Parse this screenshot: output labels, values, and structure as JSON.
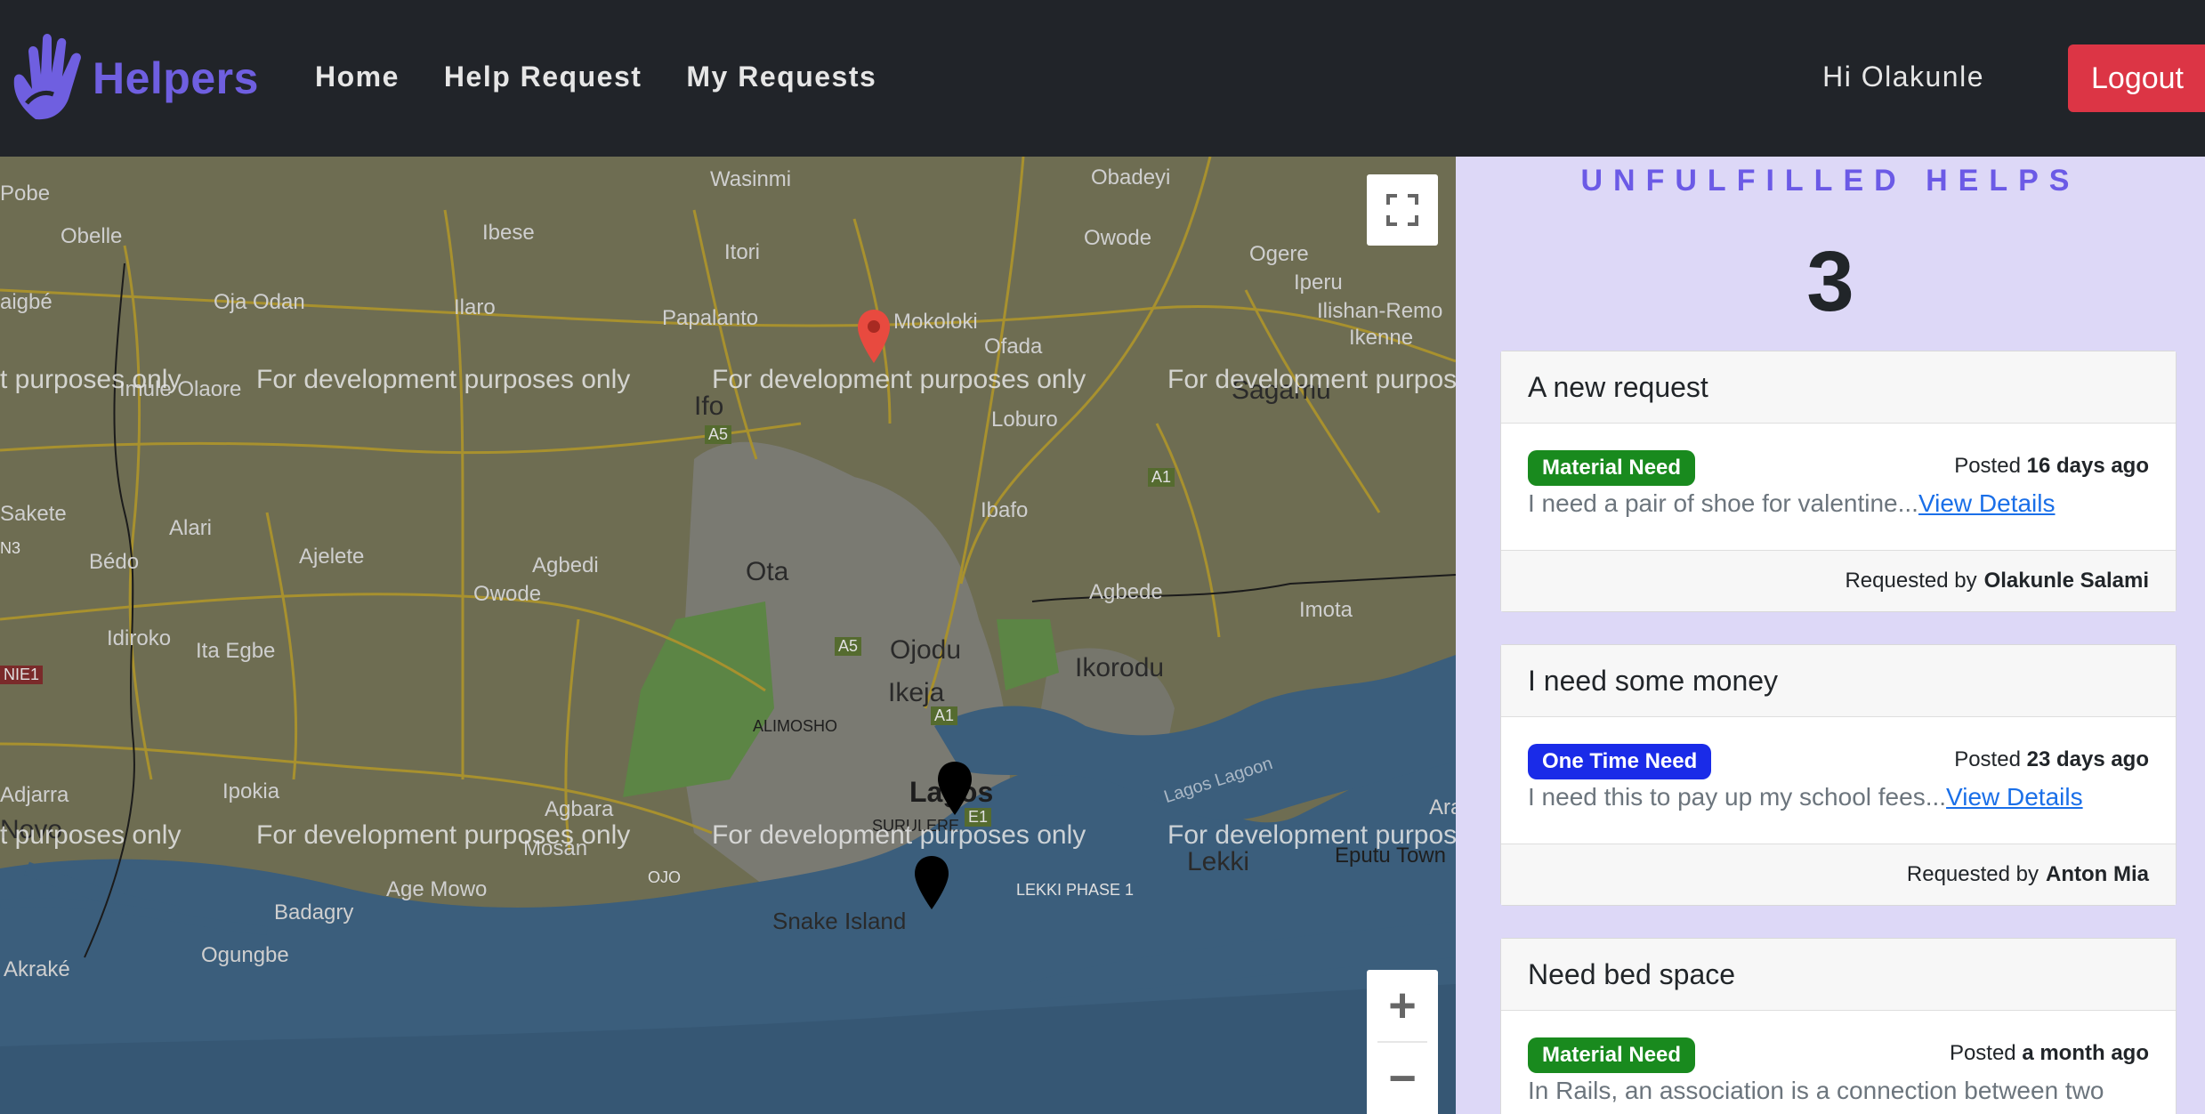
{
  "navbar": {
    "brand": "Helpers",
    "links": [
      "Home",
      "Help Request",
      "My Requests"
    ],
    "greeting": "Hi Olakunle",
    "logout_label": "Logout"
  },
  "map": {
    "watermark": "For development purposes only",
    "watermark_left": "t purposes only",
    "watermark_right": "For development purpos",
    "zoom_in": "+",
    "zoom_out": "−",
    "places": {
      "wasinmi": "Wasinmi",
      "obadeyi": "Obadeyi",
      "pobe": "Pobe",
      "obelle": "Obelle",
      "ibese": "Ibese",
      "itori": "Itori",
      "owode": "Owode",
      "ogere": "Ogere",
      "iperu": "Iperu",
      "ilishan": "Ilishan-Remo",
      "ikenne": "Ikenne",
      "aigbe": "aigbé",
      "oja_odan": "Oja Odan",
      "ilaro": "Ilaro",
      "papalanto": "Papalanto",
      "mokoloki": "Mokoloki",
      "ofada": "Ofada",
      "ifo": "Ifo",
      "loburo": "Loburo",
      "sagamu": "Sagamu",
      "imule": "Imule Olaore",
      "ibafo": "Ibafo",
      "sakete": "Sakete",
      "alari": "Alari",
      "bedo": "Bédo",
      "ajelete": "Ajelete",
      "agbedi": "Agbedi",
      "ota": "Ota",
      "owode2": "Owode",
      "agbede": "Agbede",
      "imota": "Imota",
      "idiroko": "Idiroko",
      "ita_egbe": "Ita Egbe",
      "ojodu": "Ojodu",
      "ikorodu": "Ikorodu",
      "ikeja": "Ikeja",
      "alimosho": "ALIMOSHO",
      "ipokia": "Ipokia",
      "adjarra": "Adjarra",
      "agbara": "Agbara",
      "lagos": "Lagos",
      "surulere": "SURULERE",
      "mosan": "Mosan",
      "ojo": "OJO",
      "lekki_phase": "LEKKI PHASE 1",
      "lekki": "Lekki",
      "eputu": "Eputu Town",
      "ara": "Ara",
      "age_mowo": "Age Mowo",
      "badagry": "Badagry",
      "snake": "Snake Island",
      "ogungbe": "Ogungbe",
      "akrake": "Akraké",
      "novo": "Novo",
      "lagoon": "Lagos Lagoon",
      "a5": "A5",
      "a1": "A1",
      "a5b": "A5",
      "a1b": "A1",
      "e1": "E1",
      "n3": "N3",
      "nie1": "NIE1"
    }
  },
  "sidebar": {
    "title": "UNFULFILLED HELPS",
    "count": "3",
    "cards": [
      {
        "title": "A new request",
        "badge": "Material Need",
        "badge_color": "#198a1e",
        "posted_prefix": "Posted",
        "posted_time": "16 days ago",
        "description": "I need a pair of shoe for valentine...",
        "link": "View Details",
        "requested_prefix": "Requested by",
        "requester": "Olakunle Salami"
      },
      {
        "title": "I need some money",
        "badge": "One Time Need",
        "badge_color": "#1a2be8",
        "posted_prefix": "Posted",
        "posted_time": "23 days ago",
        "description": "I need this to pay up my school fees...",
        "link": "View Details",
        "requested_prefix": "Requested by",
        "requester": "Anton Mia"
      },
      {
        "title": "Need bed space",
        "badge": "Material Need",
        "badge_color": "#198a1e",
        "posted_prefix": "Posted",
        "posted_time": "a month ago",
        "description": "In Rails, an association is a connection between two"
      }
    ]
  },
  "colors": {
    "navbar_bg": "#212429",
    "accent": "#6b5ae6",
    "logout": "#dc3545",
    "sidebar_bg": "#ddd8f7",
    "map_land": "#6e6d52",
    "map_water": "#3b5e7c"
  }
}
